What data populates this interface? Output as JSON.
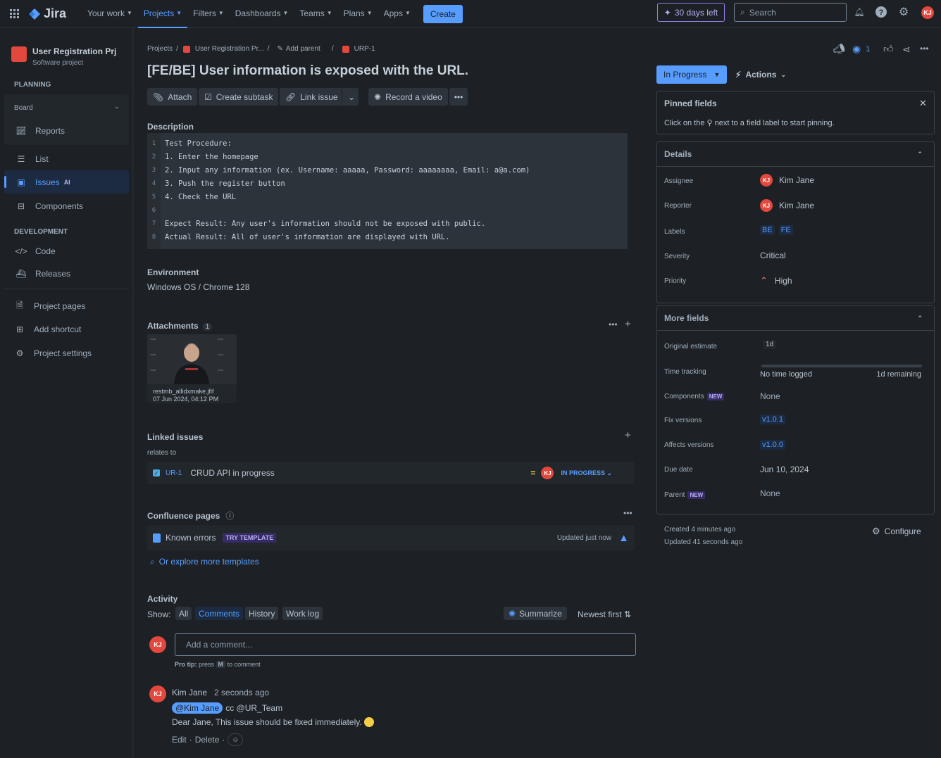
{
  "topnav": {
    "app": "Jira",
    "items": [
      {
        "label": "Your work"
      },
      {
        "label": "Projects"
      },
      {
        "label": "Filters"
      },
      {
        "label": "Dashboards"
      },
      {
        "label": "Teams"
      },
      {
        "label": "Plans"
      },
      {
        "label": "Apps"
      }
    ],
    "create": "Create",
    "trial": "30 days left",
    "search_placeholder": "Search",
    "avatar": "KJ"
  },
  "sidebar": {
    "project_name": "User Registration Prj",
    "project_type": "Software project",
    "planning": "PLANNING",
    "board": "Board",
    "reports": "Reports",
    "list": "List",
    "issues": "Issues",
    "ai_badge": "AI",
    "components": "Components",
    "development": "DEVELOPMENT",
    "code": "Code",
    "releases": "Releases",
    "project_pages": "Project pages",
    "add_shortcut": "Add shortcut",
    "project_settings": "Project settings"
  },
  "breadcrumb": {
    "projects": "Projects",
    "project": "User Registration Pr...",
    "add_parent": "Add parent",
    "key": "URP-1",
    "sep": "/"
  },
  "watch_count": "1",
  "issue": {
    "title": "[FE/BE] User information is exposed with the URL.",
    "attach": "Attach",
    "create_subtask": "Create subtask",
    "link_issue": "Link issue",
    "record_video": "Record a video",
    "description_label": "Description",
    "description_lines": [
      "Test Procedure:",
      "1. Enter the homepage",
      "2. Input any information (ex. Username: aaaaa, Password: aaaaaaaa, Email: a@a.com)",
      "3. Push the register button",
      "4. Check the URL",
      "",
      "Expect Result: Any user's information should not be exposed with public.",
      "Actual Result: All of user's information are displayed with URL."
    ],
    "line_numbers": [
      "1",
      "2",
      "3",
      "4",
      "5",
      "6",
      "7",
      "8"
    ],
    "environment_label": "Environment",
    "environment": "Windows OS / Chrome 128",
    "attachments_label": "Attachments",
    "attachments_count": "1",
    "attachment_name": "restmb_allidxmake.jfif",
    "attachment_date": "07 Jun 2024, 04:12 PM",
    "linked_label": "Linked issues",
    "relates_to": "relates to",
    "linked_key": "UR-1",
    "linked_summary": "CRUD API in progress",
    "linked_status": "IN PROGRESS",
    "linked_avatar": "KJ",
    "confluence_label": "Confluence pages",
    "conf_page": "Known errors",
    "try_template": "TRY TEMPLATE",
    "updated": "Updated just now",
    "explore": "Or explore more templates"
  },
  "activity": {
    "label": "Activity",
    "show": "Show:",
    "tabs": [
      "All",
      "Comments",
      "History",
      "Work log"
    ],
    "summarize": "Summarize",
    "newest": "Newest first",
    "placeholder": "Add a comment...",
    "protip_bold": "Pro tip:",
    "protip_pre": "press",
    "protip_key": "M",
    "protip_post": "to comment",
    "comment": {
      "author": "Kim Jane",
      "time": "2 seconds ago",
      "mention": "@Kim Jane",
      "cc": "cc @UR_Team",
      "text": "Dear Jane, This issue should be fixed immediately.",
      "edit": "Edit",
      "delete": "Delete",
      "dot": "·",
      "avatar": "KJ"
    }
  },
  "status": {
    "label": "In Progress",
    "actions": "Actions"
  },
  "pinned": {
    "title": "Pinned fields",
    "text_pre": "Click on the",
    "text_post": "next to a field label to start pinning."
  },
  "details": {
    "title": "Details",
    "assignee_l": "Assignee",
    "assignee": "Kim Jane",
    "reporter_l": "Reporter",
    "reporter": "Kim Jane",
    "labels_l": "Labels",
    "labels": [
      "BE",
      "FE"
    ],
    "severity_l": "Severity",
    "severity": "Critical",
    "priority_l": "Priority",
    "priority": "High",
    "avatar": "KJ"
  },
  "more": {
    "title": "More fields",
    "orig_l": "Original estimate",
    "orig": "1d",
    "time_l": "Time tracking",
    "time_logged": "No time logged",
    "time_remaining": "1d remaining",
    "comp_l": "Components",
    "new_badge": "NEW",
    "comp": "None",
    "fix_l": "Fix versions",
    "fix": "v1.0.1",
    "aff_l": "Affects versions",
    "aff": "v1.0.0",
    "due_l": "Due date",
    "due": "Jun 10, 2024",
    "parent_l": "Parent",
    "parent": "None"
  },
  "meta": {
    "created": "Created 4 minutes ago",
    "updated": "Updated 41 seconds ago",
    "configure": "Configure"
  },
  "colors": {
    "accent": "#579dff",
    "background": "#1d2125",
    "avatar": "#e2483d",
    "priority_high": "#f87462",
    "medium": "#f5cd47"
  }
}
